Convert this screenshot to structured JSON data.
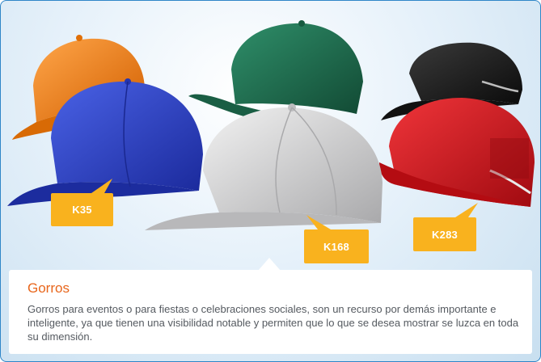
{
  "products": [
    {
      "code": "K35",
      "color": "#2a3fc0",
      "icon": "baseball-cap-blue"
    },
    {
      "code": "K168",
      "color": "#c9c9cb",
      "icon": "baseball-cap-gray"
    },
    {
      "code": "K283",
      "color": "#d0141a",
      "icon": "bump-cap-red"
    }
  ],
  "extra_caps": [
    {
      "color": "#f07b10",
      "icon": "baseball-cap-orange"
    },
    {
      "color": "#1c6e4f",
      "icon": "baseball-cap-green"
    },
    {
      "color": "#1b1b1b",
      "icon": "bump-cap-black"
    }
  ],
  "info": {
    "title": "Gorros",
    "description": "Gorros para eventos o para fiestas o celebraciones sociales, son un recurso por demás importante e inteligente, ya que tienen una visibilidad notable y permiten que lo que se desea mostrar se luzca en toda su dimensión."
  },
  "colors": {
    "accent": "#e8661c",
    "tag": "#f9b21e",
    "border": "#2f86c8"
  }
}
